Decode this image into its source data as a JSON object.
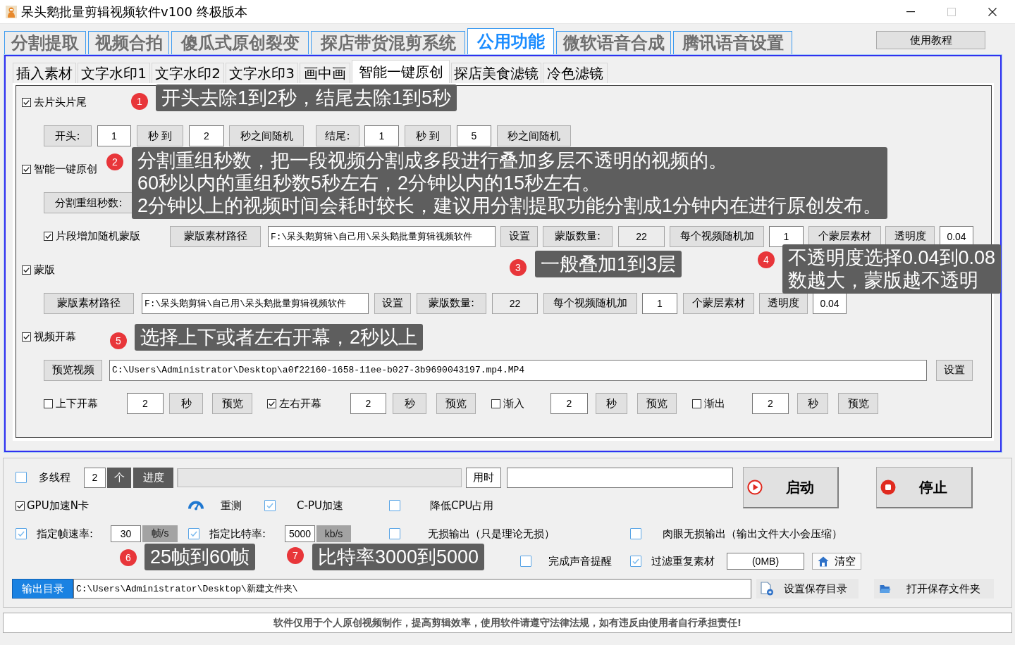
{
  "window": {
    "title": "呆头鹅批量剪辑视频软件v100 终极版本"
  },
  "main_tabs": [
    {
      "label": "分割提取",
      "selected": false
    },
    {
      "label": "视频合拍",
      "selected": false
    },
    {
      "label": "傻瓜式原创裂变",
      "selected": false
    },
    {
      "label": "探店带货混剪系统",
      "selected": false
    },
    {
      "label": "公用功能",
      "selected": true
    },
    {
      "label": "微软语音合成",
      "selected": false
    },
    {
      "label": "腾讯语音设置",
      "selected": false
    }
  ],
  "tutorial_button": "使用教程",
  "sub_tabs": [
    {
      "label": "插入素材",
      "selected": false
    },
    {
      "label": "文字水印1",
      "selected": false
    },
    {
      "label": "文字水印2",
      "selected": false
    },
    {
      "label": "文字水印3",
      "selected": false
    },
    {
      "label": "画中画",
      "selected": false
    },
    {
      "label": "智能一键原创",
      "selected": true
    },
    {
      "label": "探店美食滤镜",
      "selected": false
    },
    {
      "label": "冷色滤镜",
      "selected": false
    }
  ],
  "panel_rows": [
    {
      "items": [
        {
          "kind": "checkbox",
          "label": "去片头片尾",
          "checked": true
        }
      ]
    },
    {
      "items": [
        {
          "kind": "button",
          "label": "开头:"
        },
        {
          "kind": "field",
          "value": "1"
        },
        {
          "kind": "button",
          "label": "秒 到"
        },
        {
          "kind": "field",
          "value": "2"
        },
        {
          "kind": "button",
          "label": "秒之间随机"
        },
        {
          "kind": "button",
          "label": "结尾:"
        },
        {
          "kind": "field",
          "value": "1"
        },
        {
          "kind": "button",
          "label": "秒 到"
        },
        {
          "kind": "field",
          "value": "5"
        },
        {
          "kind": "button",
          "label": "秒之间随机"
        }
      ]
    },
    {
      "items": [
        {
          "kind": "checkbox",
          "label": "智能一键原创",
          "checked": true
        }
      ]
    },
    {
      "items": [
        {
          "kind": "button",
          "label": "分割重组秒数:"
        }
      ]
    },
    {
      "items": [
        {
          "kind": "checkbox",
          "label": "片段增加随机蒙版",
          "checked": true
        },
        {
          "kind": "button",
          "label": "蒙版素材路径"
        },
        {
          "kind": "path-field",
          "value": "F:\\呆头鹅剪辑\\自己用\\呆头鹅批量剪辑视频软件"
        },
        {
          "kind": "button",
          "label": "设置"
        },
        {
          "kind": "button",
          "label": "蒙版数量:"
        },
        {
          "kind": "readonly-field",
          "value": "22"
        },
        {
          "kind": "button",
          "label": "每个视频随机加"
        },
        {
          "kind": "field",
          "value": "1"
        },
        {
          "kind": "button",
          "label": "个蒙层素材"
        },
        {
          "kind": "button",
          "label": "透明度"
        },
        {
          "kind": "field",
          "value": "0.04"
        }
      ]
    },
    {
      "items": [
        {
          "kind": "checkbox",
          "label": "蒙版",
          "checked": true
        }
      ]
    },
    {
      "items": [
        {
          "kind": "button",
          "label": "蒙版素材路径"
        },
        {
          "kind": "path-field",
          "value": "F:\\呆头鹅剪辑\\自己用\\呆头鹅批量剪辑视频软件"
        },
        {
          "kind": "button",
          "label": "设置"
        },
        {
          "kind": "button",
          "label": "蒙版数量:"
        },
        {
          "kind": "readonly-field",
          "value": "22"
        },
        {
          "kind": "button",
          "label": "每个视频随机加"
        },
        {
          "kind": "field",
          "value": "1"
        },
        {
          "kind": "button",
          "label": "个蒙层素材"
        },
        {
          "kind": "button",
          "label": "透明度"
        },
        {
          "kind": "field",
          "value": "0.04"
        }
      ]
    },
    {
      "items": [
        {
          "kind": "checkbox",
          "label": "视频开幕",
          "checked": true
        }
      ]
    },
    {
      "items": [
        {
          "kind": "button",
          "label": "预览视频"
        },
        {
          "kind": "path-field",
          "value": "C:\\Users\\Administrator\\Desktop\\a0f22160-1658-11ee-b027-3b9690043197.mp4.MP4"
        },
        {
          "kind": "button",
          "label": "设置"
        }
      ]
    },
    {
      "items": [
        {
          "kind": "checkbox",
          "label": "上下开幕",
          "checked": false
        },
        {
          "kind": "field",
          "value": "2"
        },
        {
          "kind": "button",
          "label": "秒"
        },
        {
          "kind": "button",
          "label": "预览"
        },
        {
          "kind": "checkbox",
          "label": "左右开幕",
          "checked": true
        },
        {
          "kind": "field",
          "value": "2"
        },
        {
          "kind": "button",
          "label": "秒"
        },
        {
          "kind": "button",
          "label": "预览"
        },
        {
          "kind": "checkbox",
          "label": "渐入",
          "checked": false
        },
        {
          "kind": "field",
          "value": "2"
        },
        {
          "kind": "button",
          "label": "秒"
        },
        {
          "kind": "button",
          "label": "预览"
        },
        {
          "kind": "checkbox",
          "label": "渐出",
          "checked": false
        },
        {
          "kind": "field",
          "value": "2"
        },
        {
          "kind": "button",
          "label": "秒"
        },
        {
          "kind": "button",
          "label": "预览"
        }
      ]
    }
  ],
  "bottom_rows": [
    {
      "items": [
        {
          "kind": "check",
          "label": "多线程",
          "checked": false
        },
        {
          "kind": "field",
          "value": "2"
        },
        {
          "kind": "tag",
          "label": "个"
        },
        {
          "kind": "tag",
          "label": "进度"
        },
        {
          "kind": "progress",
          "level": 0
        },
        {
          "kind": "boxed-label",
          "label": "用时"
        },
        {
          "kind": "field"
        }
      ]
    },
    {
      "items": [
        {
          "kind": "classic-check",
          "label": "GPU加速N卡",
          "checked": true
        },
        {
          "kind": "retest-button",
          "label": "重测"
        },
        {
          "kind": "check",
          "label": "C-PU加速",
          "checked": true
        },
        {
          "kind": "check",
          "label": "降低CPU占用",
          "checked": false
        }
      ]
    },
    {
      "items": [
        {
          "kind": "check",
          "label": "指定帧速率:",
          "checked": true
        },
        {
          "kind": "field",
          "value": "30"
        },
        {
          "kind": "unit",
          "label": "帧/s"
        },
        {
          "kind": "check",
          "label": "指定比特率:",
          "checked": true
        },
        {
          "kind": "field",
          "value": "5000"
        },
        {
          "kind": "unit",
          "label": "kb/s"
        },
        {
          "kind": "check",
          "label": "无损输出（只是理论无损）",
          "checked": false
        },
        {
          "kind": "check",
          "label": "肉眼无损输出（输出文件大小会压缩）",
          "checked": false
        }
      ]
    },
    {
      "items": [
        {
          "kind": "check",
          "label": "完成声音提醒",
          "checked": false
        },
        {
          "kind": "check",
          "label": "过滤重复素材",
          "checked": true
        },
        {
          "kind": "field",
          "value": "(0MB)"
        },
        {
          "kind": "clear-button",
          "label": "清空"
        }
      ]
    },
    {
      "items": [
        {
          "kind": "path-label",
          "label": "输出目录"
        },
        {
          "kind": "path-field",
          "value": "C:\\Users\\Administrator\\Desktop\\新建文件夹\\"
        },
        {
          "kind": "save-dir-button",
          "label": "设置保存目录"
        },
        {
          "kind": "open-dir-button",
          "label": "打开保存文件夹"
        }
      ]
    }
  ],
  "run_buttons": [
    {
      "kind": "start",
      "label": "启动"
    },
    {
      "kind": "stop",
      "label": "停止"
    }
  ],
  "footer_notice": "软件仅用于个人原创视频制作，提高剪辑效率，使用软件请遵守法律法规，如有违反由使用者自行承担责任!",
  "annotations": [
    {
      "number": "1",
      "lines": [
        "开头去除1到2秒，结尾去除1到5秒"
      ]
    },
    {
      "number": "2",
      "lines": [
        "分割重组秒数，把一段视频分割成多段进行叠加多层不透明的视频的。",
        "60秒以内的重组秒数5秒左右，2分钟以内的15秒左右。",
        "2分钟以上的视频时间会耗时较长，建议用分割提取功能分割成1分钟内在进行原创发布。"
      ]
    },
    {
      "number": "3",
      "lines": [
        "一般叠加1到3层"
      ]
    },
    {
      "number": "4",
      "lines": [
        "不透明度选择0.04到0.08",
        "数越大，蒙版越不透明"
      ]
    },
    {
      "number": "5",
      "lines": [
        "选择上下或者左右开幕，2秒以上"
      ]
    },
    {
      "number": "6",
      "lines": [
        "25帧到60帧"
      ]
    },
    {
      "number": "7",
      "lines": [
        "比特率3000到5000"
      ]
    }
  ]
}
